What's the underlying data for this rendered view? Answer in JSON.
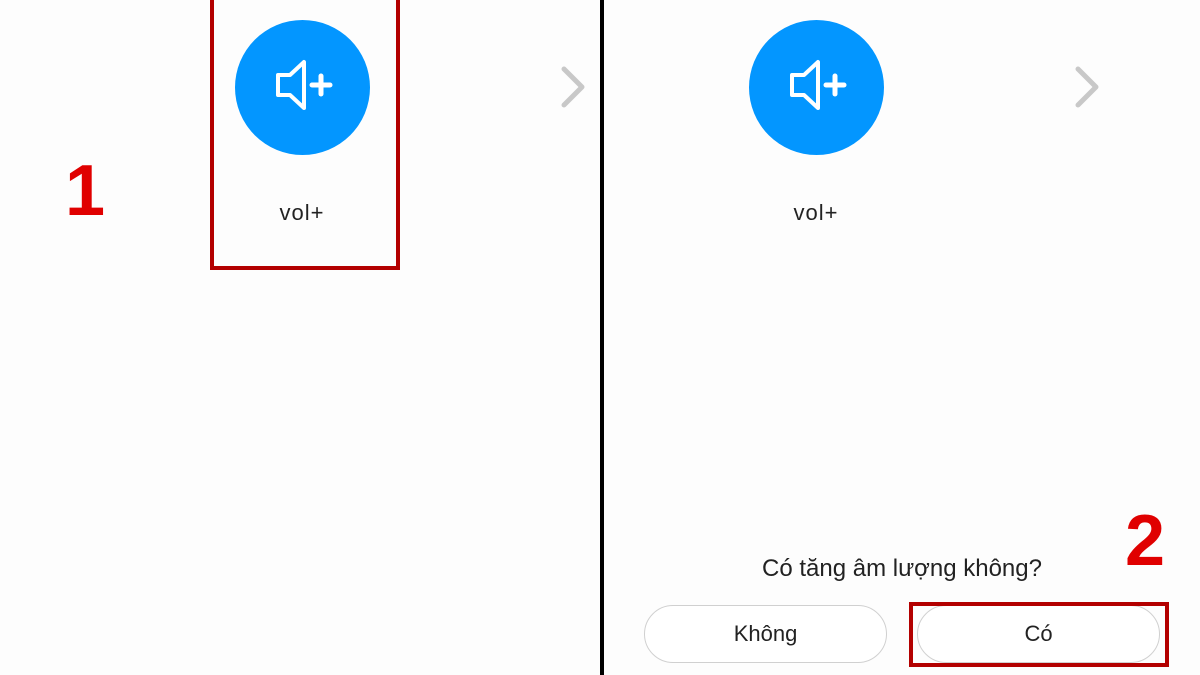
{
  "step_labels": {
    "one": "1",
    "two": "2"
  },
  "left": {
    "vol_label": "vol+"
  },
  "right": {
    "vol_label": "vol+",
    "prompt": "Có tăng âm lượng không?",
    "btn_no": "Không",
    "btn_yes": "Có"
  },
  "colors": {
    "accent": "#0396ff",
    "highlight": "#b30000",
    "step": "#e00000"
  }
}
